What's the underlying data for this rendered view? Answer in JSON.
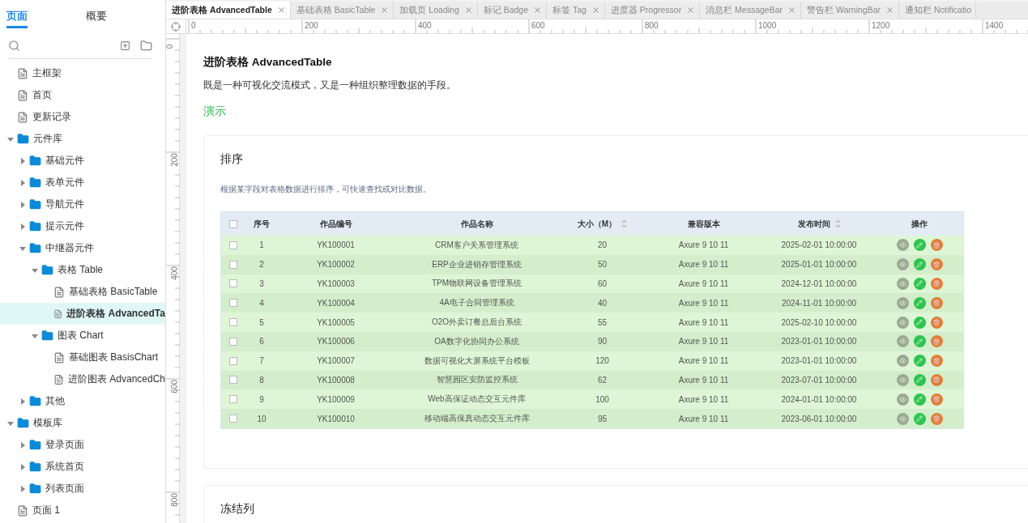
{
  "left_tabs": [
    {
      "label": "页面",
      "selected": true
    },
    {
      "label": "概要",
      "selected": false
    }
  ],
  "tree": [
    {
      "label": "主框架",
      "kind": "page",
      "selected": false
    },
    {
      "label": "首页",
      "kind": "page",
      "selected": false
    },
    {
      "label": "更新记录",
      "kind": "page",
      "selected": false
    },
    {
      "label": "元件库",
      "kind": "folder",
      "expanded": true,
      "selected": false,
      "children": [
        {
          "label": "基础元件",
          "kind": "folder",
          "expanded": false,
          "selected": false
        },
        {
          "label": "表单元件",
          "kind": "folder",
          "expanded": false,
          "selected": false
        },
        {
          "label": "导航元件",
          "kind": "folder",
          "expanded": false,
          "selected": false
        },
        {
          "label": "提示元件",
          "kind": "folder",
          "expanded": false,
          "selected": false
        },
        {
          "label": "中继器元件",
          "kind": "folder",
          "expanded": true,
          "selected": false,
          "children": [
            {
              "label": "表格 Table",
              "kind": "folder",
              "expanded": true,
              "selected": false,
              "children": [
                {
                  "label": "基础表格 BasicTable",
                  "kind": "page",
                  "selected": false
                },
                {
                  "label": "进阶表格 AdvancedTa",
                  "kind": "page",
                  "selected": true
                }
              ]
            },
            {
              "label": "图表 Chart",
              "kind": "folder",
              "expanded": true,
              "selected": false,
              "children": [
                {
                  "label": "基础图表 BasisChart",
                  "kind": "page",
                  "selected": false
                },
                {
                  "label": "进阶图表 AdvancedCh",
                  "kind": "page",
                  "selected": false
                }
              ]
            }
          ]
        },
        {
          "label": "其他",
          "kind": "folder",
          "expanded": false,
          "selected": false
        }
      ]
    },
    {
      "label": "模板库",
      "kind": "folder",
      "expanded": true,
      "selected": false,
      "children": [
        {
          "label": "登录页面",
          "kind": "folder",
          "expanded": false,
          "selected": false
        },
        {
          "label": "系统首页",
          "kind": "folder",
          "expanded": false,
          "selected": false
        },
        {
          "label": "列表页面",
          "kind": "folder",
          "expanded": false,
          "selected": false
        }
      ]
    },
    {
      "label": "页面 1",
      "kind": "page",
      "selected": false
    }
  ],
  "doc_tabs": [
    {
      "label": "进阶表格 AdvancedTable",
      "selected": true
    },
    {
      "label": "基础表格 BasicTable",
      "selected": false
    },
    {
      "label": "加载页 Loading",
      "selected": false
    },
    {
      "label": "标记 Badge",
      "selected": false
    },
    {
      "label": "标签 Tag",
      "selected": false
    },
    {
      "label": "进度器 Progressor",
      "selected": false
    },
    {
      "label": "消息栏 MessageBar",
      "selected": false
    },
    {
      "label": "警告栏 WarningBar",
      "selected": false
    },
    {
      "label": "通知栏 Notificatio",
      "selected": false
    }
  ],
  "ruler_h": [
    "0",
    "200",
    "400",
    "600",
    "800",
    "1000",
    "1200",
    "1400"
  ],
  "ruler_v": [
    "0",
    "200",
    "400",
    "600",
    "800"
  ],
  "page": {
    "title": "进阶表格 AdvancedTable",
    "description": "既是一种可视化交流模式，又是一种组织整理数据的手段。",
    "section": "演示"
  },
  "cards": [
    {
      "title": "排序",
      "description": "根据某字段对表格数据进行排序，可快速查找或对比数据。",
      "table": {
        "header_checked": false,
        "columns": [
          {
            "label": "序号",
            "kind": "plain"
          },
          {
            "label": "作品编号",
            "kind": "plain"
          },
          {
            "label": "作品名称",
            "kind": "plain"
          },
          {
            "label": "大小（M）",
            "kind": "sortable"
          },
          {
            "label": "兼容版本",
            "kind": "plain"
          },
          {
            "label": "发布时间",
            "kind": "sortable"
          },
          {
            "label": "操作",
            "kind": "plain"
          }
        ],
        "rows": [
          {
            "checked": false,
            "cells": [
              "1",
              "YK100001",
              "CRM客户关系管理系统",
              "20",
              "Axure 9 10 11",
              "2025-02-01 10:00:00"
            ]
          },
          {
            "checked": false,
            "cells": [
              "2",
              "YK100002",
              "ERP企业进销存管理系统",
              "50",
              "Axure 9 10 11",
              "2025-01-01 10:00:00"
            ]
          },
          {
            "checked": false,
            "cells": [
              "3",
              "YK100003",
              "TPM物联网设备管理系统",
              "60",
              "Axure 9 10 11",
              "2024-12-01 10:00:00"
            ]
          },
          {
            "checked": false,
            "cells": [
              "4",
              "YK100004",
              "4A电子合同管理系统",
              "40",
              "Axure 9 10 11",
              "2024-11-01 10:00:00"
            ]
          },
          {
            "checked": false,
            "cells": [
              "5",
              "YK100005",
              "O2O外卖订餐总后台系统",
              "55",
              "Axure 9 10 11",
              "2025-02-10 10:00:00"
            ]
          },
          {
            "checked": false,
            "cells": [
              "6",
              "YK100006",
              "OA数字化协同办公系统",
              "90",
              "Axure 9 10 11",
              "2023-01-01 10:00:00"
            ]
          },
          {
            "checked": false,
            "cells": [
              "7",
              "YK100007",
              "数据可视化大屏系统平台模板",
              "120",
              "Axure 9 10 11",
              "2023-01-01 10:00:00"
            ]
          },
          {
            "checked": false,
            "cells": [
              "8",
              "YK100008",
              "智慧园区安防监控系统",
              "62",
              "Axure 9 10 11",
              "2023-07-01 10:00:00"
            ]
          },
          {
            "checked": false,
            "cells": [
              "9",
              "YK100009",
              "Web高保证动态交互元件库",
              "100",
              "Axure 9 10 11",
              "2024-01-01 10:00:00"
            ]
          },
          {
            "checked": false,
            "cells": [
              "10",
              "YK100010",
              "移动端高保真动态交互元件库",
              "95",
              "Axure 9 10 11",
              "2023-06-01 10:00:00"
            ]
          }
        ]
      }
    },
    {
      "title": "冻结列"
    }
  ]
}
